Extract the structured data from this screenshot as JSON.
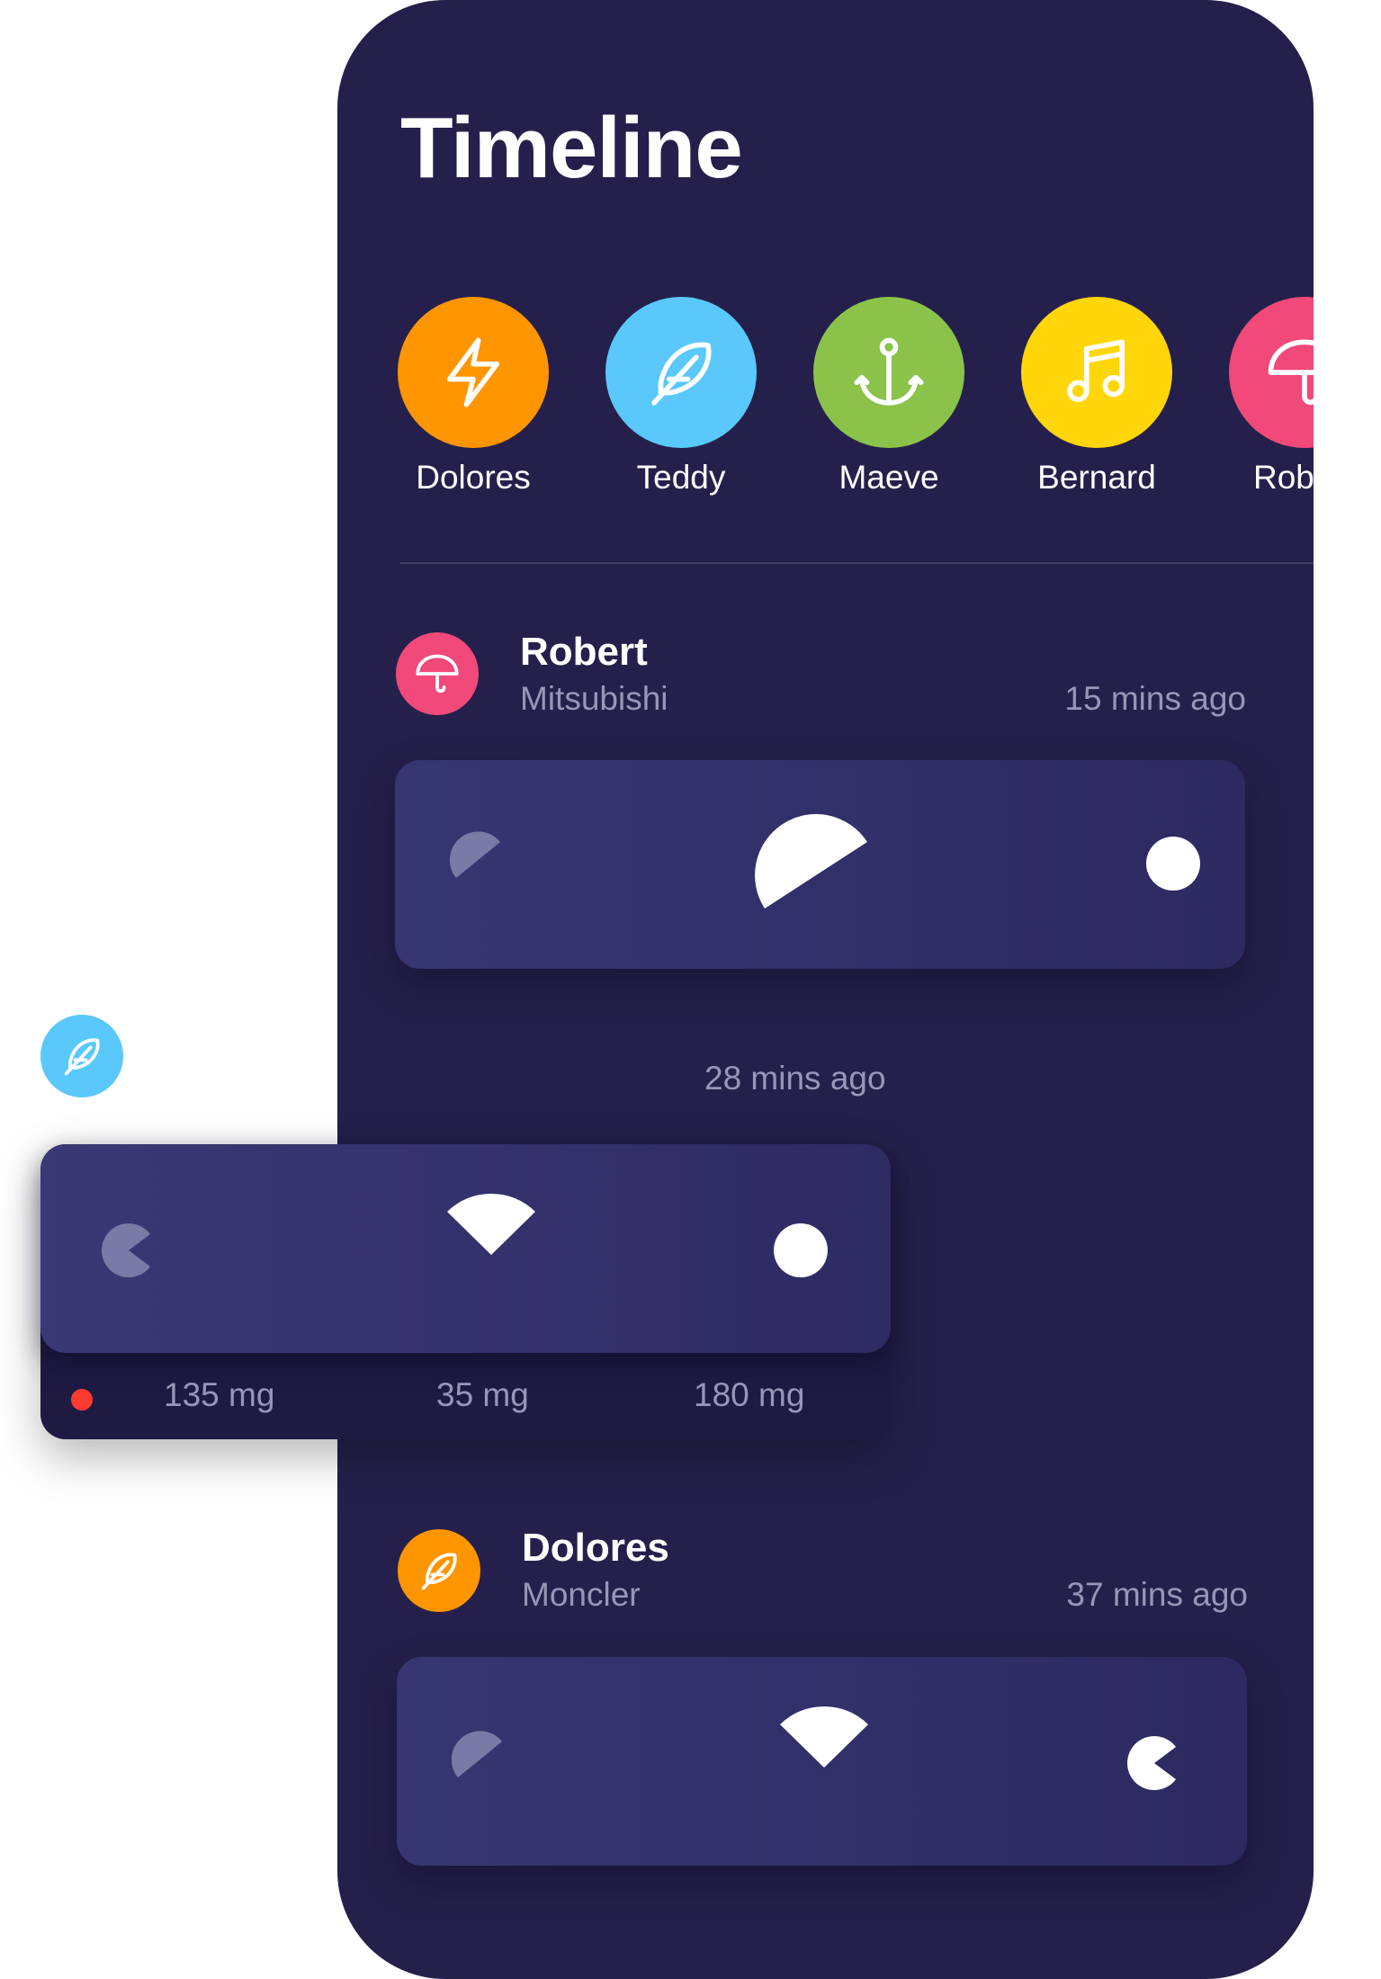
{
  "header": {
    "title": "Timeline"
  },
  "stories": [
    {
      "name": "Dolores",
      "color": "#ff9500",
      "icon": "lightning-icon"
    },
    {
      "name": "Teddy",
      "color": "#5ac8fa",
      "icon": "feather-icon"
    },
    {
      "name": "Maeve",
      "color": "#8bc34a",
      "icon": "anchor-icon"
    },
    {
      "name": "Bernard",
      "color": "#ffd60a",
      "icon": "music-note-icon"
    },
    {
      "name": "Rob",
      "color": "#f0497a",
      "icon": "umbrella-icon"
    }
  ],
  "posts": [
    {
      "name": "Robert",
      "subtitle": "Mitsubishi",
      "time": "15 mins ago",
      "avatar_color": "#f0497a",
      "avatar_icon": "umbrella-icon"
    },
    {
      "name": "Dolores",
      "subtitle": "Moncler",
      "time": "37 mins ago",
      "avatar_color": "#ff9500",
      "avatar_icon": "feather-icon"
    }
  ],
  "middle_entry": {
    "time": "28 mins ago",
    "avatar_color": "#5ac8fa",
    "avatar_icon": "feather-icon",
    "doses": [
      "135 mg",
      "35 mg",
      "180 mg"
    ],
    "indicator_color": "#ff3b30"
  }
}
